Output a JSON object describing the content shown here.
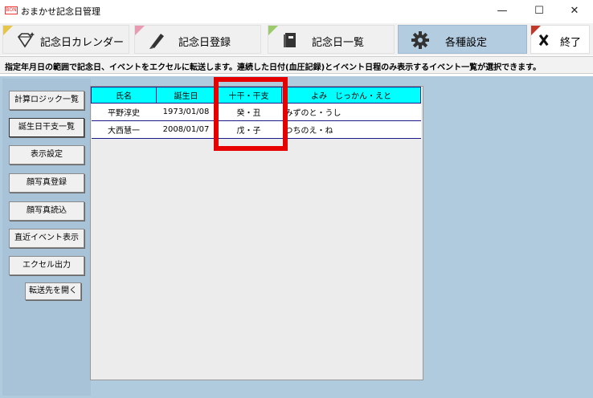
{
  "window": {
    "title": "おまかせ記念日管理",
    "app_icon_text": "BON",
    "min_glyph": "—",
    "max_glyph": "☐",
    "close_glyph": "✕"
  },
  "tabs": [
    {
      "label": "記念日カレンダー",
      "icon": "diamond-icon"
    },
    {
      "label": "記念日登録",
      "icon": "pen-icon"
    },
    {
      "label": "記念日一覧",
      "icon": "book-icon"
    },
    {
      "label": "各種設定",
      "icon": "gear-icon"
    },
    {
      "label": "終了",
      "icon": "x-icon"
    }
  ],
  "info": "指定年月日の範囲で記念日、イベントをエクセルに転送します。連続した日付(血圧記録)とイベント日程のみ表示するイベント一覧が選択できます。",
  "sidebar": {
    "buttons": [
      "計算ロジック一覧",
      "誕生日干支一覧",
      "表示設定",
      "顔写真登録",
      "顔写真読込",
      "直近イベント表示",
      "エクセル出力",
      "転送先を開く"
    ]
  },
  "table": {
    "headers": [
      "氏名",
      "誕生日",
      "十干・干支",
      "よみ　じっかん・えと"
    ],
    "rows": [
      [
        "平野淳史",
        "1973/01/08",
        "癸・丑",
        "みずのと・うし"
      ],
      [
        "大西慧一",
        "2008/01/07",
        "戊・子",
        "つちのえ・ね"
      ]
    ]
  },
  "colors": {
    "header_bg": "#00ffff",
    "panel_bg": "#b0cade",
    "highlight": "#e60000",
    "selected_tab": "#b4cce0"
  }
}
